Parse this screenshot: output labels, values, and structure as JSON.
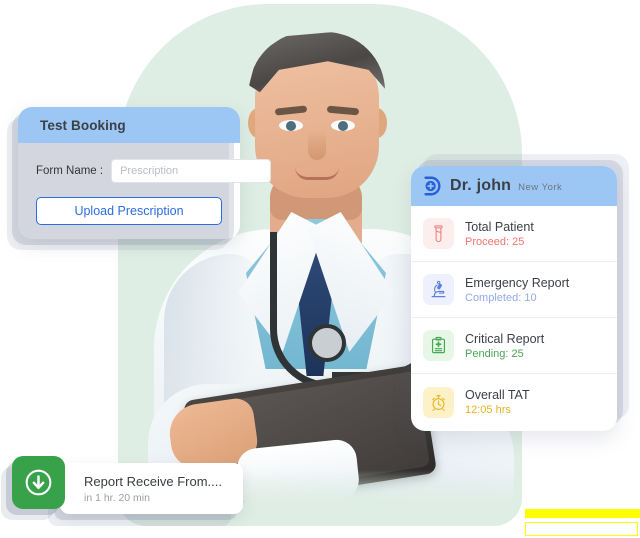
{
  "background": {
    "blob_color": "#dfeee4",
    "page_color": "#ffffff"
  },
  "hero": {
    "subject_alt": "doctor-with-tablet"
  },
  "test_booking": {
    "title": "Test Booking",
    "header_color": "#9cc7f5",
    "form_label": "Form Name :",
    "form_value": "",
    "form_placeholder": "Prescription",
    "upload_label": "Upload Prescription",
    "upload_accent": "#2b6de0"
  },
  "doctor_card": {
    "logo_icon": "d-plus-logo-icon",
    "name": "Dr. john",
    "location": "New York",
    "header_color": "#9cc7f5",
    "stats": [
      {
        "icon": "test-tube-icon",
        "title": "Total Patient",
        "sub_label": "Proceed:",
        "sub_value": "25",
        "tile_bg": "#fdeeee",
        "accent": "#f08080"
      },
      {
        "icon": "microscope-icon",
        "title": "Emergency Report",
        "sub_label": "Completed:",
        "sub_value": "10",
        "tile_bg": "#eef1fd",
        "accent": "#8fa8e8"
      },
      {
        "icon": "clipboard-plus-icon",
        "title": "Critical Report",
        "sub_label": "Pending:",
        "sub_value": "25",
        "tile_bg": "#e6f7e8",
        "accent": "#47a852"
      },
      {
        "icon": "alarm-clock-icon",
        "title": "Overall TAT",
        "sub_label": "12:05 hrs",
        "sub_value": "",
        "tile_bg": "#fdf1c8",
        "accent": "#e8b92e"
      }
    ]
  },
  "notification": {
    "icon": "download-circle-icon",
    "icon_bg": "#37a24a",
    "title": "Report Receive From....",
    "subtitle": "in 1 hr. 20 min"
  },
  "accent_bars": {
    "color": "#ffff00"
  }
}
